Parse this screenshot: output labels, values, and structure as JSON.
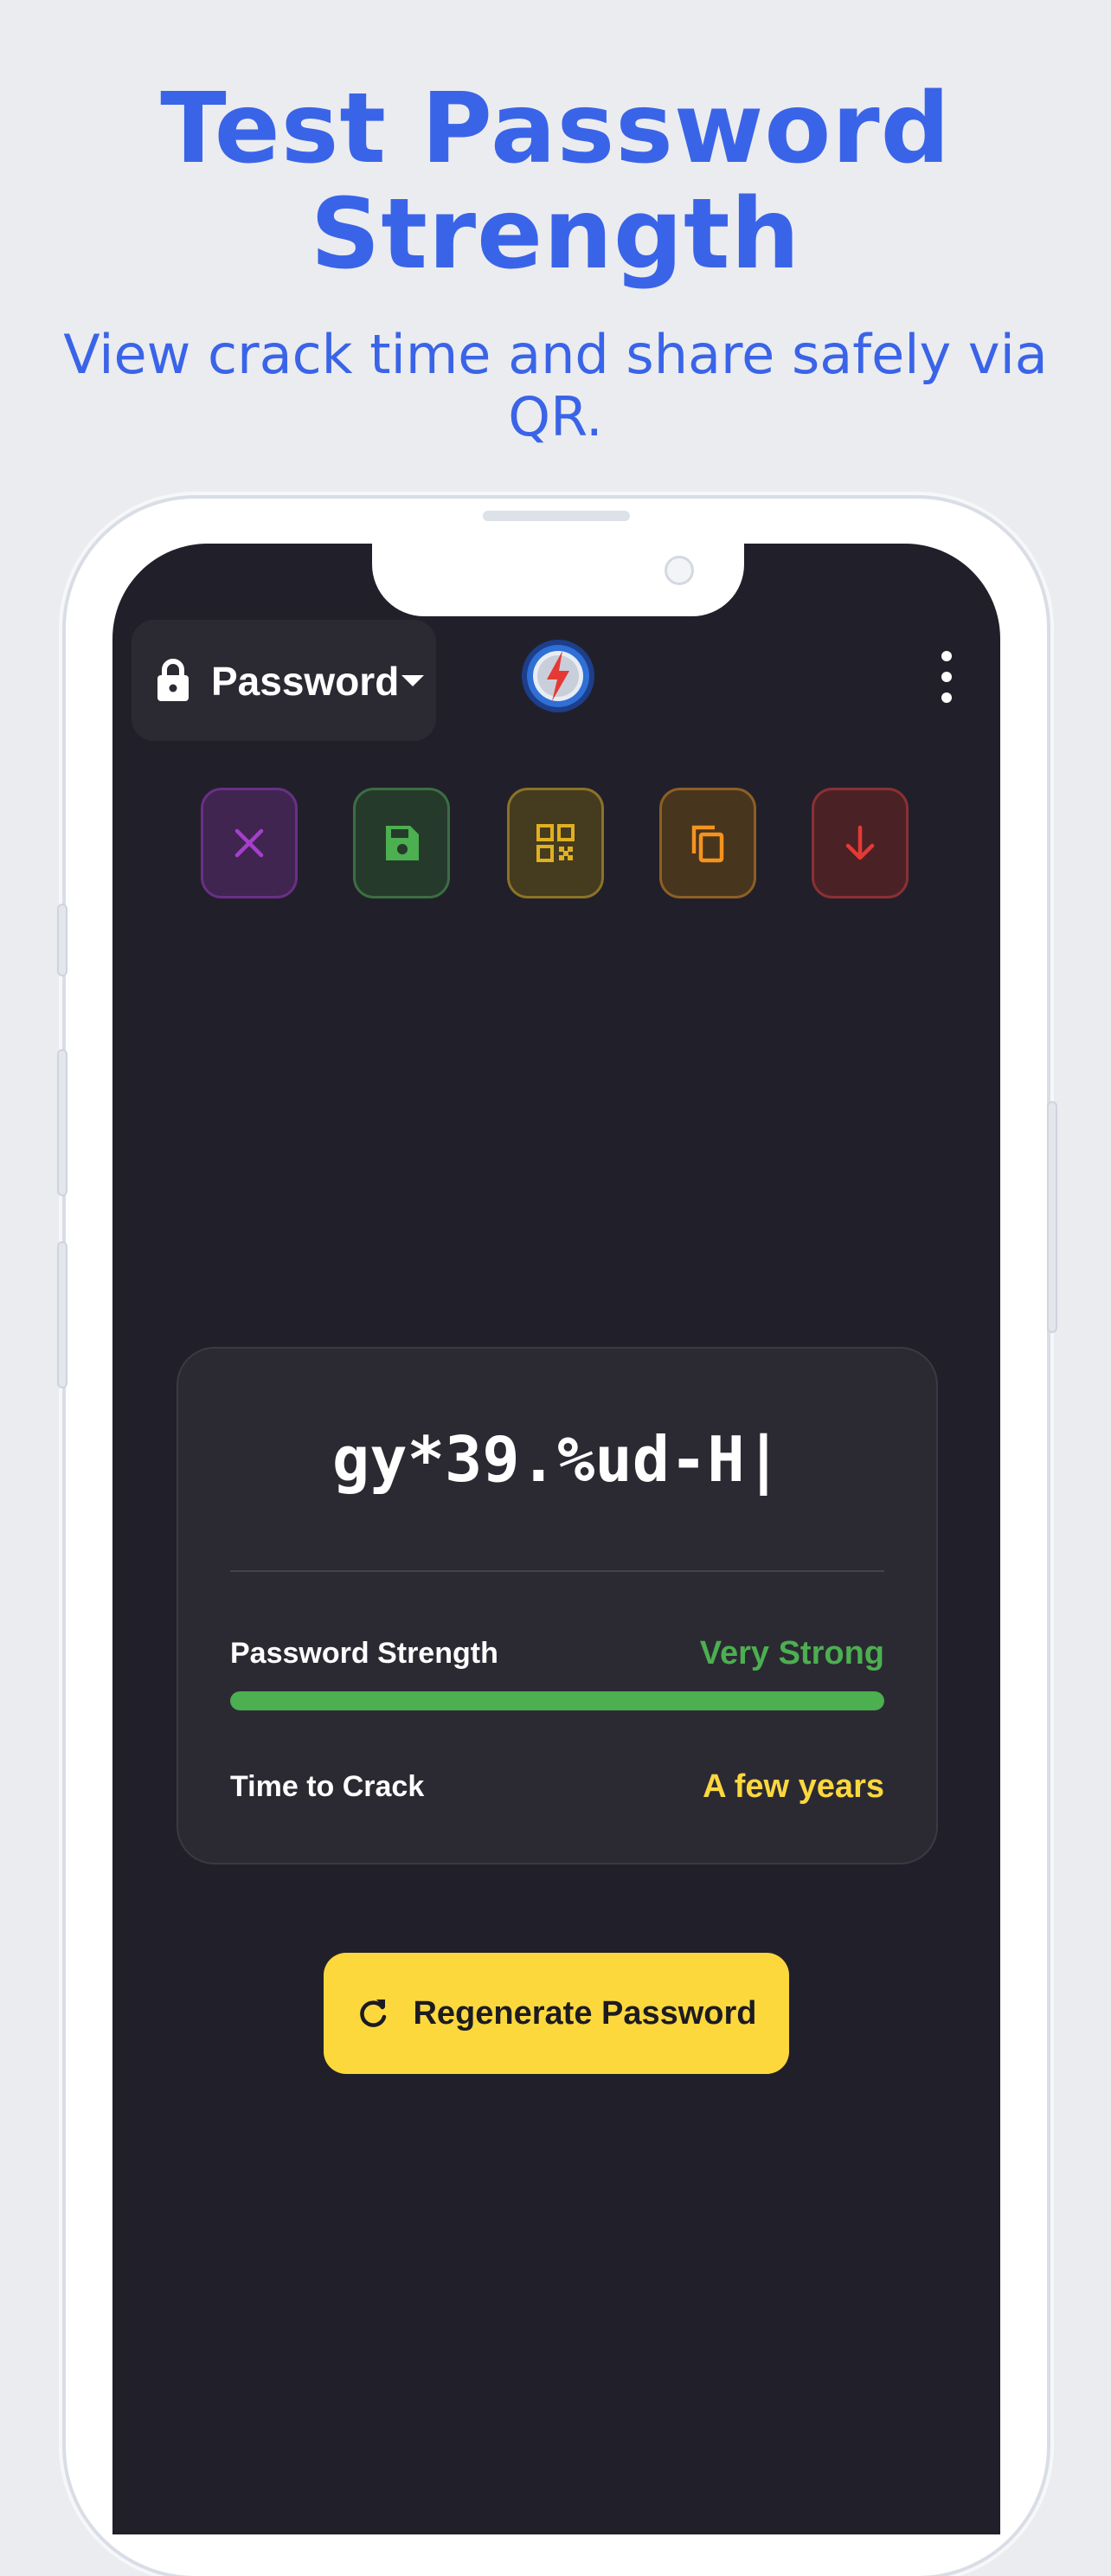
{
  "promo": {
    "headline_line1": "Test Password",
    "headline_line2": "Strength",
    "subhead_line1": "View crack time and share safely via",
    "subhead_line2": "QR."
  },
  "toolbar": {
    "mode_label": "Password",
    "icons": {
      "mode": "lock-icon",
      "dropdown": "caret-down-icon",
      "logo": "lightning-bolt-logo-icon",
      "menu": "vertical-dots-menu-icon"
    }
  },
  "actions": [
    {
      "name": "clear",
      "icon": "close-icon",
      "color": "#9c27b0"
    },
    {
      "name": "save",
      "icon": "floppy-disk-icon",
      "color": "#4caf50"
    },
    {
      "name": "qr",
      "icon": "qr-code-icon",
      "color": "#e0b020"
    },
    {
      "name": "copy",
      "icon": "copy-icon",
      "color": "#f5931f"
    },
    {
      "name": "download",
      "icon": "arrow-down-icon",
      "color": "#e53935"
    }
  ],
  "password_card": {
    "password": "gy*39.%ud-H|",
    "strength_label": "Password Strength",
    "strength_value": "Very Strong",
    "strength_fraction": 1.0,
    "strength_color": "#4caf50",
    "crack_label": "Time to Crack",
    "crack_value": "A few years",
    "crack_color": "#fdd83d"
  },
  "regenerate": {
    "label": "Regenerate Password",
    "icon": "refresh-icon"
  },
  "colors": {
    "accent": "#3a64e8",
    "screen_background": "#21202a",
    "card_background": "#2b2a33",
    "button_yellow": "#fdd83d"
  }
}
